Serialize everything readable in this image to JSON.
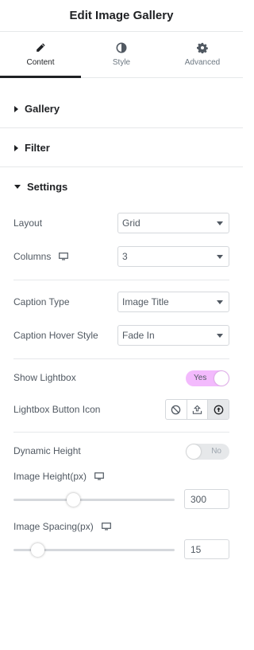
{
  "header": {
    "title": "Edit Image Gallery"
  },
  "tabs": [
    {
      "label": "Content",
      "icon": "pencil-icon",
      "active": true
    },
    {
      "label": "Style",
      "icon": "half-circle-icon",
      "active": false
    },
    {
      "label": "Advanced",
      "icon": "gear-icon",
      "active": false
    }
  ],
  "sections": {
    "gallery": "Gallery",
    "filter": "Filter",
    "settings": "Settings"
  },
  "settings": {
    "layout": {
      "label": "Layout",
      "value": "Grid"
    },
    "columns": {
      "label": "Columns",
      "value": "3",
      "responsive_icon": "monitor-icon"
    },
    "caption_type": {
      "label": "Caption Type",
      "value": "Image Title"
    },
    "caption_hover_style": {
      "label": "Caption Hover Style",
      "value": "Fade In"
    },
    "show_lightbox": {
      "label": "Show Lightbox",
      "state": "Yes"
    },
    "lightbox_button_icon": {
      "label": "Lightbox Button Icon",
      "options": [
        "none-icon",
        "upload-icon",
        "arrow-up-circle-icon"
      ],
      "selected": "arrow-up-circle-icon"
    },
    "dynamic_height": {
      "label": "Dynamic Height",
      "state": "No"
    },
    "image_height": {
      "label": "Image Height(px)",
      "value": "300",
      "slider_fraction": 0.37
    },
    "image_spacing": {
      "label": "Image Spacing(px)",
      "value": "15",
      "slider_fraction": 0.15
    }
  },
  "colors": {
    "toggle_on": "#f3bafd",
    "toggle_off": "#e6e8ea",
    "text_dark": "#1f2124"
  }
}
